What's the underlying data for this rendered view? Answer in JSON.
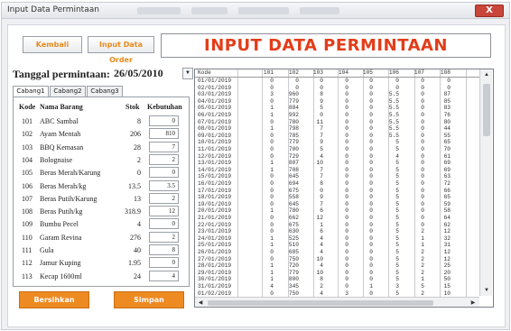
{
  "window": {
    "title": "Input Data Permintaan",
    "close_label": "X"
  },
  "toolbar": {
    "back_label": "Kembali",
    "order_label": "Input Data Order"
  },
  "banner": {
    "title": "INPUT DATA PERMINTAAN"
  },
  "date_field": {
    "label": "Tanggal permintaan:",
    "value": "26/05/2010"
  },
  "tabs": [
    {
      "label": "Cabang1",
      "active": true
    },
    {
      "label": "Cabang2",
      "active": false
    },
    {
      "label": "Cabang3",
      "active": false
    }
  ],
  "items_table": {
    "headers": {
      "kode": "Kode",
      "nama": "Nama Barang",
      "stok": "Stok",
      "kebutuhan": "Kebutuhan"
    },
    "rows": [
      {
        "kode": "101",
        "nama": "ABC Sambal",
        "stok": "8",
        "kebutuhan": "0"
      },
      {
        "kode": "102",
        "nama": "Ayam Mentah",
        "stok": "206",
        "kebutuhan": "810"
      },
      {
        "kode": "103",
        "nama": "BBQ Kemasan",
        "stok": "28",
        "kebutuhan": "7"
      },
      {
        "kode": "104",
        "nama": "Bolognaise",
        "stok": "2",
        "kebutuhan": "2"
      },
      {
        "kode": "105",
        "nama": "Beras Merah/Karung",
        "stok": "0",
        "kebutuhan": "0"
      },
      {
        "kode": "106",
        "nama": "Beras Merah/kg",
        "stok": "13.5",
        "kebutuhan": "3.5"
      },
      {
        "kode": "107",
        "nama": "Beras Putih/Karung",
        "stok": "13",
        "kebutuhan": "2"
      },
      {
        "kode": "108",
        "nama": "Beras Putih/kg",
        "stok": "318.9",
        "kebutuhan": "12"
      },
      {
        "kode": "109",
        "nama": "Bumbu Pecel",
        "stok": "4",
        "kebutuhan": "0"
      },
      {
        "kode": "110",
        "nama": "Garam Revina",
        "stok": "276",
        "kebutuhan": "2"
      },
      {
        "kode": "111",
        "nama": "Gula",
        "stok": "40",
        "kebutuhan": "8"
      },
      {
        "kode": "112",
        "nama": "Jamur Kuping",
        "stok": "1.95",
        "kebutuhan": "0"
      },
      {
        "kode": "113",
        "nama": "Kecap 1600ml",
        "stok": "24",
        "kebutuhan": "4"
      }
    ]
  },
  "actions": {
    "clear_label": "Bersihkan",
    "save_label": "Simpan"
  },
  "history_grid": {
    "headers": [
      "Kode",
      "101",
      "102",
      "103",
      "104",
      "105",
      "106",
      "107",
      "108"
    ],
    "rows": [
      [
        "01/01/2019",
        "0",
        "0",
        "0",
        "0",
        "0",
        "0",
        "0",
        "0"
      ],
      [
        "02/01/2019",
        "0",
        "0",
        "0",
        "0",
        "0",
        "0",
        "0",
        "0"
      ],
      [
        "03/01/2019",
        "3",
        "960",
        "8",
        "0",
        "0",
        "5.5",
        "0",
        "87"
      ],
      [
        "04/01/2019",
        "0",
        "779",
        "9",
        "0",
        "0",
        "5.5",
        "0",
        "85"
      ],
      [
        "05/01/2019",
        "1",
        "884",
        "5",
        "0",
        "0",
        "5.5",
        "0",
        "83"
      ],
      [
        "06/01/2019",
        "1",
        "992",
        "0",
        "0",
        "0",
        "5.5",
        "0",
        "76"
      ],
      [
        "07/01/2019",
        "0",
        "780",
        "11",
        "0",
        "0",
        "5.5",
        "0",
        "80"
      ],
      [
        "08/01/2019",
        "1",
        "798",
        "7",
        "0",
        "0",
        "5.5",
        "0",
        "44"
      ],
      [
        "09/01/2019",
        "0",
        "785",
        "7",
        "0",
        "0",
        "5.5",
        "0",
        "55"
      ],
      [
        "10/01/2019",
        "0",
        "779",
        "9",
        "0",
        "0",
        "5",
        "0",
        "65"
      ],
      [
        "11/01/2019",
        "0",
        "700",
        "5",
        "0",
        "0",
        "5",
        "0",
        "70"
      ],
      [
        "12/01/2019",
        "0",
        "729",
        "4",
        "0",
        "0",
        "4",
        "0",
        "61"
      ],
      [
        "13/01/2019",
        "1",
        "807",
        "10",
        "0",
        "0",
        "5",
        "0",
        "69"
      ],
      [
        "14/01/2019",
        "1",
        "708",
        "7",
        "0",
        "0",
        "5",
        "0",
        "69"
      ],
      [
        "15/01/2019",
        "0",
        "645",
        "7",
        "0",
        "0",
        "5",
        "0",
        "63"
      ],
      [
        "16/01/2019",
        "0",
        "694",
        "8",
        "0",
        "0",
        "5",
        "0",
        "72"
      ],
      [
        "17/01/2019",
        "0",
        "675",
        "0",
        "0",
        "0",
        "5",
        "0",
        "66"
      ],
      [
        "18/01/2019",
        "0",
        "558",
        "9",
        "0",
        "0",
        "5",
        "0",
        "65"
      ],
      [
        "19/01/2019",
        "0",
        "645",
        "7",
        "0",
        "0",
        "5",
        "0",
        "59"
      ],
      [
        "20/01/2019",
        "1",
        "780",
        "6",
        "0",
        "0",
        "5",
        "0",
        "58"
      ],
      [
        "21/01/2019",
        "0",
        "662",
        "12",
        "0",
        "0",
        "5",
        "0",
        "64"
      ],
      [
        "22/01/2019",
        "0",
        "675",
        "1",
        "0",
        "0",
        "5",
        "0",
        "62"
      ],
      [
        "23/01/2019",
        "0",
        "630",
        "6",
        "0",
        "0",
        "5",
        "2",
        "12"
      ],
      [
        "24/01/2019",
        "1",
        "525",
        "4",
        "0",
        "0",
        "5",
        "1",
        "32"
      ],
      [
        "25/01/2019",
        "1",
        "510",
        "4",
        "0",
        "0",
        "5",
        "1",
        "31"
      ],
      [
        "26/01/2019",
        "0",
        "685",
        "4",
        "0",
        "0",
        "5",
        "2",
        "12"
      ],
      [
        "27/01/2019",
        "0",
        "750",
        "10",
        "0",
        "0",
        "5",
        "2",
        "12"
      ],
      [
        "28/01/2019",
        "1",
        "720",
        "4",
        "0",
        "0",
        "5",
        "2",
        "25"
      ],
      [
        "29/01/2019",
        "1",
        "779",
        "10",
        "0",
        "0",
        "5",
        "2",
        "20"
      ],
      [
        "30/01/2019",
        "1",
        "800",
        "8",
        "0",
        "0",
        "5",
        "1",
        "50"
      ],
      [
        "31/01/2019",
        "4",
        "345",
        "2",
        "0",
        "1",
        "3",
        "5",
        "15"
      ],
      [
        "01/02/2019",
        "0",
        "750",
        "4",
        "3",
        "0",
        "5",
        "2",
        "10"
      ]
    ]
  }
}
